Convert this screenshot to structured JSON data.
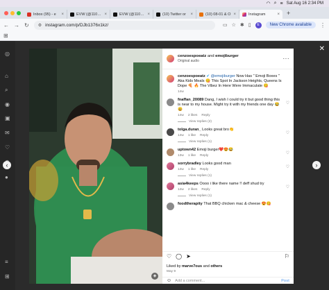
{
  "menubar": {
    "datetime": "Sat Aug 16  2:34 PM"
  },
  "tabs": [
    {
      "title": "Inbox (95) - e",
      "color": "#d93025"
    },
    {
      "title": "EVW (@11010)",
      "color": "#111111"
    },
    {
      "title": "EVW (@11010)",
      "color": "#111111"
    },
    {
      "title": "(10) Twitter or",
      "color": "#111111"
    },
    {
      "title": "(10) 08-01 & O",
      "color": "#e8710a"
    },
    {
      "title": "Instagram",
      "color": "#d6249f",
      "active": true
    }
  ],
  "address": {
    "url": "instagram.com/p/DJb1376x1kz/",
    "new_chrome": "New Chrome available",
    "profile_initial": "E"
  },
  "post": {
    "header": {
      "authors_a": "cenzoespoeatz",
      "and": "and",
      "authors_b": "emojiburger",
      "audio": "Original audio"
    },
    "caption": {
      "user": "cenzoespoeatz",
      "mention": "@emojiburger",
      "text": "Now Has \" Emoji Boxes \" Aka Kids Meals 😋 This Spot In Jackson Heights, Queens Is Dope 🍕 🔥 The Vibez In Here Were Immaculate 😋",
      "time": "14w"
    },
    "comments": [
      {
        "user": "fnaffan_20089",
        "text": "Dang, I wish I could try it but good thing this is near to my house. Might try it with my friends one day 😂😀",
        "time": "14w",
        "likes": "2 likes",
        "reply": "Reply",
        "view_replies": "View replies (2)"
      },
      {
        "user": "tolga.duran_",
        "text": "Looks great bro👏",
        "time": "14w",
        "likes": "1 like",
        "reply": "Reply",
        "view_replies": "View replies (1)"
      },
      {
        "user": "uptown42",
        "text": "Emoji burger❤️😍😂",
        "time": "13w",
        "likes": "1 like",
        "reply": "Reply"
      },
      {
        "user": "sorrybradley",
        "text": "Looks good man",
        "time": "14w",
        "likes": "1 like",
        "reply": "Reply",
        "view_replies": "View replies (1)"
      },
      {
        "user": "asia4keeps",
        "text": "Oooo i like there name !! deff shud try",
        "time": "14w",
        "likes": "2 likes",
        "reply": "Reply",
        "view_replies": "View replies (1)"
      },
      {
        "user": "foodtherapity",
        "text": "That BBQ chicken mac & cheese 😍😋",
        "time": "",
        "likes": "",
        "reply": ""
      }
    ],
    "liked_by": {
      "prefix": "Liked by",
      "user": "marve7ous",
      "and": "and",
      "others": "others"
    },
    "date": "May 9",
    "add_comment": "Add a comment...",
    "post_label": "Post"
  }
}
